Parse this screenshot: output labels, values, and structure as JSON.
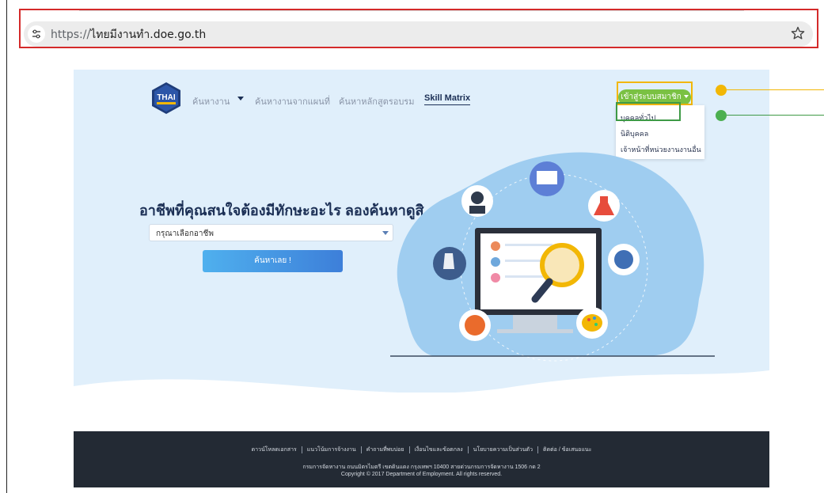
{
  "browser": {
    "url_scheme": "https://",
    "url_host": "ไทยมีงานทำ.doe.go.th",
    "site_info_icon": "tune-icon",
    "bookmark_icon": "star-icon"
  },
  "header": {
    "logo_text": "THAI",
    "nav": {
      "find_job": "ค้นหางาน",
      "find_job_map": "ค้นหางานจากแผนที่",
      "find_course": "ค้นหาหลักสูตรอบรม",
      "skill_matrix": "Skill Matrix"
    },
    "login_label": "เข้าสู่ระบบสมาชิก",
    "login_menu": [
      "บุคคลทั่วไป",
      "นิติบุคคล",
      "เจ้าหน้าที่หน่วยงานงานอื่น"
    ]
  },
  "hero": {
    "title": "อาชีพที่คุณสนใจต้องมีทักษะอะไร ลองค้นหาดูสิ",
    "select_value": "กรุณาเลือกอาชีพ",
    "search_label": "ค้นหาเลย !"
  },
  "footer": {
    "links": [
      "ดาวน์โหลดเอกสาร",
      "แนวโน้มการจ้างงาน",
      "คำถามที่พบบ่อย",
      "เงื่อนไขและข้อตกลง",
      "นโยบายความเป็นส่วนตัว",
      "ติดต่อ / ข้อเสนอแนะ"
    ],
    "address": "กรมการจัดหางาน ถนนมิตรไมตรี เขตดินแดง กรุงเทพฯ 10400 สายด่วนกรมการจัดหางาน 1506 กด 2",
    "copyright": "Copyright © 2017 Department of Employment. All rights reserved."
  },
  "colors": {
    "hero_bg": "#e0effb",
    "navy": "#1b2f55",
    "login_green": "#7ac143",
    "highlight_yellow": "#f2b705",
    "highlight_green": "#3e9a46",
    "address_outline": "#d42a2a",
    "footer_bg": "#232a34"
  }
}
